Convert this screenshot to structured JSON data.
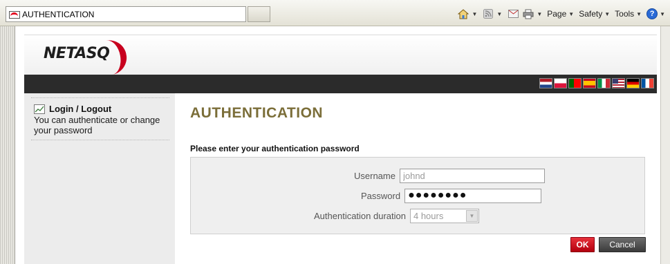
{
  "browser": {
    "tab_title": "AUTHENTICATION",
    "toolbar": {
      "page_label": "Page",
      "safety_label": "Safety",
      "tools_label": "Tools",
      "help_glyph": "?"
    }
  },
  "header": {
    "logo_text": "NETASQ",
    "flags": [
      "netherlands-flag",
      "poland-flag",
      "portugal-flag",
      "spain-flag",
      "italy-flag",
      "usa-flag",
      "germany-flag",
      "france-flag"
    ]
  },
  "sidebar": {
    "item_title": "Login / Logout",
    "item_description": "You can authenticate or change your password"
  },
  "main": {
    "title": "AUTHENTICATION",
    "prompt": "Please enter your authentication password",
    "form": {
      "username_label": "Username",
      "username_value": "johnd",
      "password_label": "Password",
      "password_value": "●●●●●●●●",
      "duration_label": "Authentication duration",
      "duration_value": "4 hours"
    },
    "buttons": {
      "ok_label": "OK",
      "cancel_label": "Cancel"
    }
  },
  "colors": {
    "title_color": "#7b6e39",
    "ok_button": "#d0121f",
    "dark_band": "#2b2b2b",
    "sidebar_bg": "#ececec"
  }
}
